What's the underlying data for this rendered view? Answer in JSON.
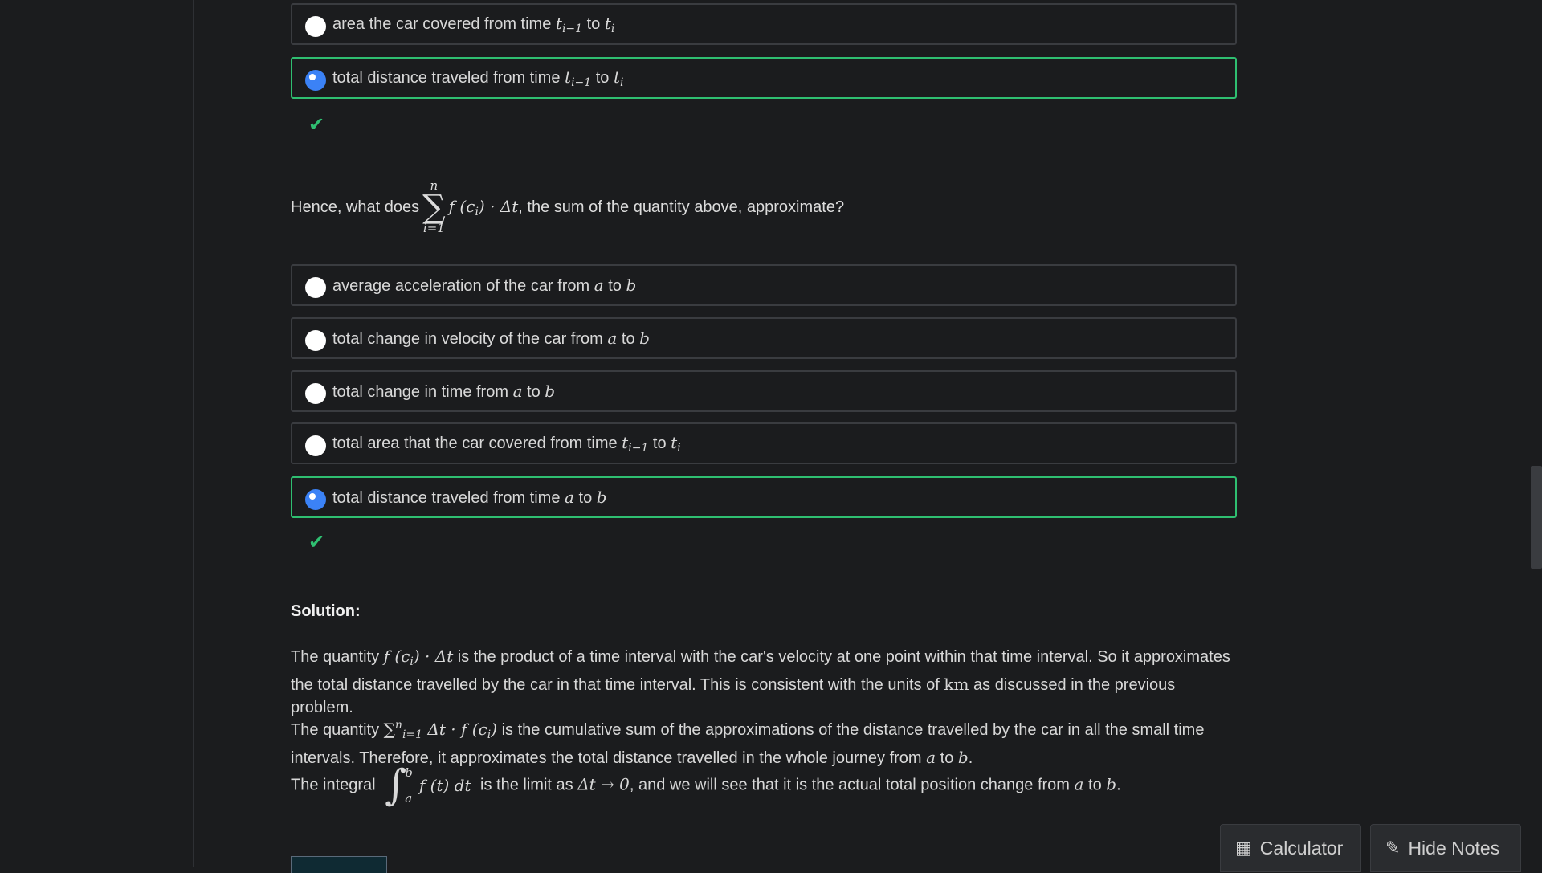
{
  "q1": {
    "options": [
      {
        "text": "area the car covered from time ",
        "math1": "t",
        "sub1": "i−1",
        "mid": " to ",
        "math2": "t",
        "sub2": "i",
        "selected": false,
        "correct": false
      },
      {
        "text": "total distance traveled from time ",
        "math1": "t",
        "sub1": "i−1",
        "mid": " to ",
        "math2": "t",
        "sub2": "i",
        "selected": true,
        "correct": true
      }
    ]
  },
  "q2": {
    "prompt_before": "Hence, what does",
    "sum_sup": "n",
    "sum_sub": "i=1",
    "sum_expr": "f (c",
    "sum_expr_sub": "i",
    "sum_expr_tail": ") · Δt",
    "prompt_after": ", the sum of the quantity above, approximate?",
    "options": [
      {
        "text": "average acceleration of the car from ",
        "a": "a",
        "mid": " to ",
        "b": "b"
      },
      {
        "text": "total change in velocity of the car from ",
        "a": "a",
        "mid": " to ",
        "b": "b"
      },
      {
        "text": "total change in time from ",
        "a": "a",
        "mid": " to ",
        "b": "b"
      },
      {
        "text": "total area that the car covered from time ",
        "a": "t",
        "a_sub": "i−1",
        "mid": " to ",
        "b": "t",
        "b_sub": "i"
      },
      {
        "text": "total distance traveled from time ",
        "a": "a",
        "mid": " to ",
        "b": "b",
        "selected": true
      }
    ]
  },
  "solution": {
    "title": "Solution:",
    "p1_a": "The quantity ",
    "p1_b": " is the product of a time interval with the car's velocity at one point within that time interval. So it approximates the total distance travelled by the car in that time interval. This is consistent with the units of ",
    "p1_unit": "km",
    "p1_c": " as discussed in the previous problem.",
    "p2_a": "The quantity ",
    "p2_b": " is the cumulative sum of the approximations of the distance travelled by the car in all the small time intervals. Therefore, it approximates the total distance travelled in the whole journey from ",
    "p2_c": ".",
    "p3_a": "The integral ",
    "p3_b": " is the limit as ",
    "p3_c": ", and we will see that it is the actual total position change from ",
    "p3_d": "."
  },
  "buttons": {
    "calculator": "Calculator",
    "hide_notes": "Hide Notes"
  },
  "colors": {
    "background": "#1b1c1e",
    "correct_border": "#2fbf71",
    "selected_radio": "#3b82f6"
  }
}
